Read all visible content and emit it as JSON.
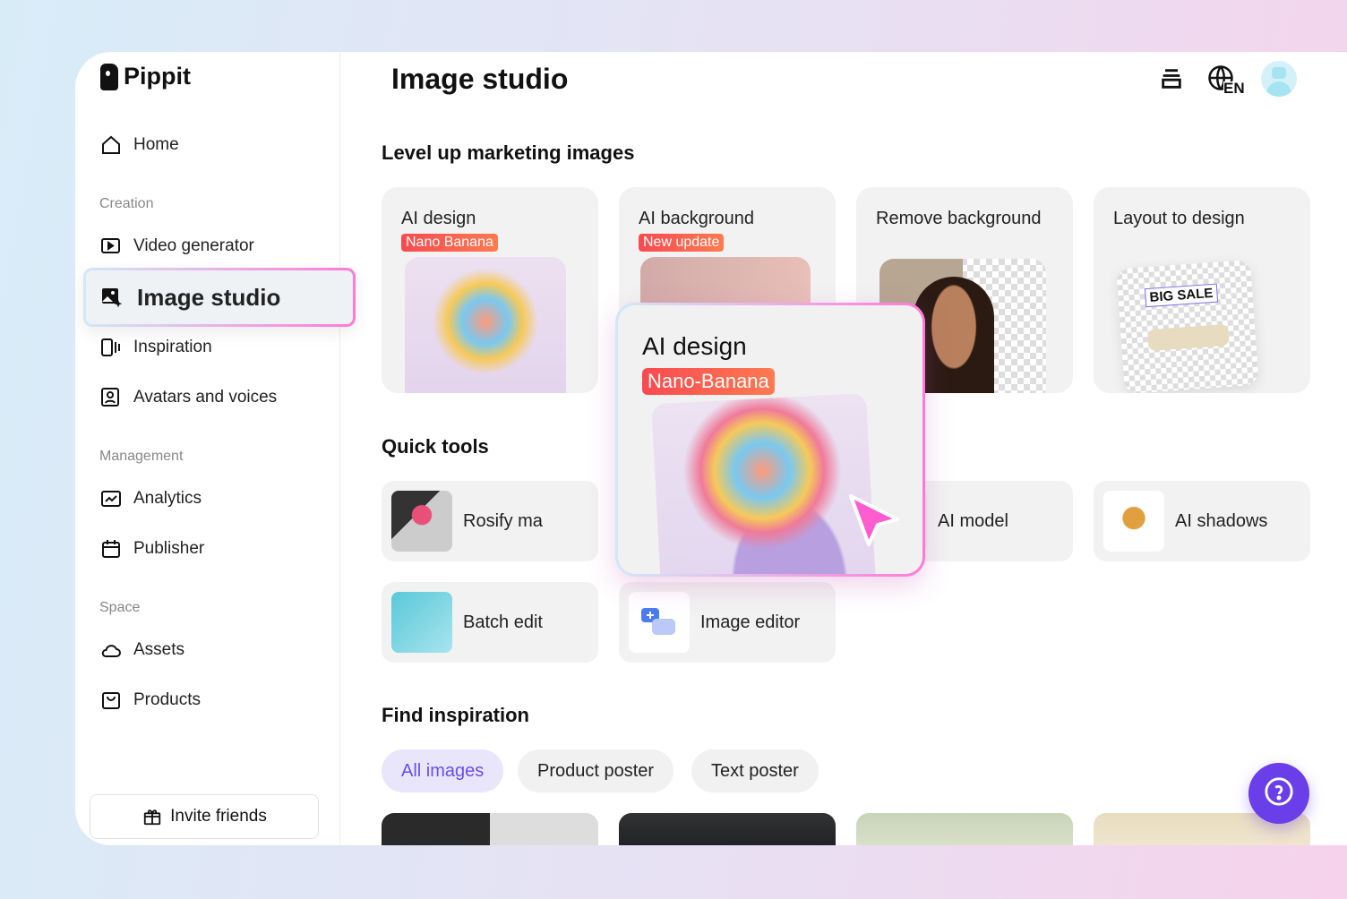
{
  "app": {
    "name": "Pippit"
  },
  "sidebar": {
    "home": "Home",
    "sections": {
      "creation": "Creation",
      "management": "Management",
      "space": "Space"
    },
    "items": {
      "video_generator": "Video generator",
      "image_studio": "Image studio",
      "inspiration": "Inspiration",
      "avatars": "Avatars and voices",
      "analytics": "Analytics",
      "publisher": "Publisher",
      "assets": "Assets",
      "products": "Products"
    },
    "invite": "Invite friends"
  },
  "header": {
    "title": "Image studio",
    "language": "EN"
  },
  "marketing": {
    "heading": "Level up marketing images",
    "cards": [
      {
        "title": "AI design",
        "badge": "Nano Banana"
      },
      {
        "title": "AI background",
        "badge": "New update"
      },
      {
        "title": "Remove background"
      },
      {
        "title": "Layout to design",
        "sticker": "BIG SALE"
      }
    ]
  },
  "popup": {
    "title": "AI design",
    "badge": "Nano-Banana"
  },
  "quick_tools": {
    "heading": "Quick tools",
    "items": [
      "Rosify ma",
      "AI model",
      "AI shadows",
      "Batch edit",
      "Image editor"
    ]
  },
  "inspiration": {
    "heading": "Find inspiration",
    "filters": [
      "All images",
      "Product poster",
      "Text poster"
    ],
    "active_filter": "All images"
  },
  "colors": {
    "accent": "#6a3ee8",
    "badge": "#f84a50",
    "highlight": "#ff7ad6"
  }
}
